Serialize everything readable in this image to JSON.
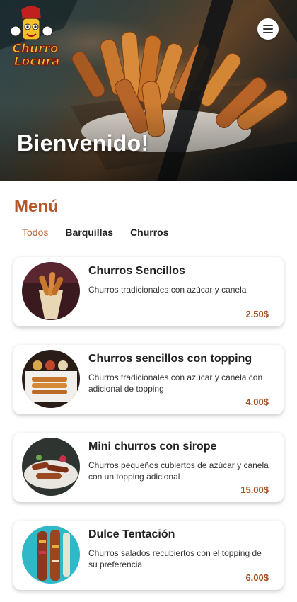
{
  "hero": {
    "welcome": "Bienvenido!",
    "logo_text_line1": "Churro",
    "logo_text_line2": "Locura",
    "menu_icon": "hamburger-menu-icon"
  },
  "menu": {
    "title": "Menú",
    "tabs": [
      {
        "label": "Todos",
        "active": true
      },
      {
        "label": "Barquillas",
        "active": false
      },
      {
        "label": "Churros",
        "active": false
      }
    ]
  },
  "products": [
    {
      "name": "Churros Sencillos",
      "description": "Churros tradicionales con azúcar y canela",
      "price": "2.50$"
    },
    {
      "name": "Churros sencillos con topping",
      "description": "Churros tradicionales con azúcar y canela con adicional de topping",
      "price": "4.00$"
    },
    {
      "name": "Mini churros con sirope",
      "description": "Churros pequeños cubiertos de azúcar y canela con un topping adicional",
      "price": "15.00$"
    },
    {
      "name": "Dulce Tentación",
      "description": "Churros salados recubiertos con el topping de su preferencia",
      "price": "6.00$"
    }
  ],
  "colors": {
    "accent": "#b5562a",
    "price": "#a94d20",
    "active_tab": "#c0642f"
  }
}
